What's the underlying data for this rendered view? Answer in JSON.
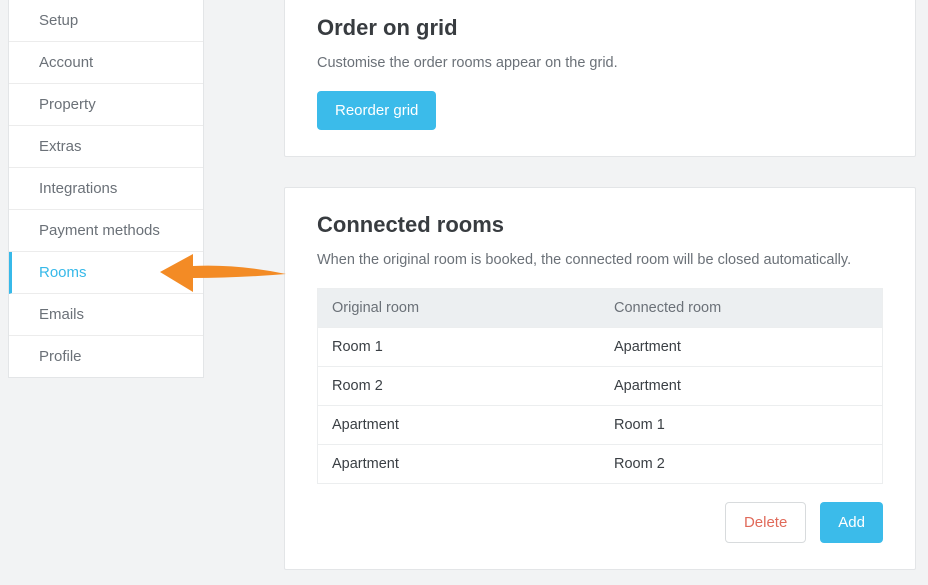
{
  "sidebar": {
    "items": [
      {
        "label": "Setup",
        "active": false
      },
      {
        "label": "Account",
        "active": false
      },
      {
        "label": "Property",
        "active": false
      },
      {
        "label": "Extras",
        "active": false
      },
      {
        "label": "Integrations",
        "active": false
      },
      {
        "label": "Payment methods",
        "active": false
      },
      {
        "label": "Rooms",
        "active": true
      },
      {
        "label": "Emails",
        "active": false
      },
      {
        "label": "Profile",
        "active": false
      }
    ]
  },
  "order_card": {
    "title": "Order on grid",
    "description": "Customise the order rooms appear on the grid.",
    "button": "Reorder grid"
  },
  "connected_card": {
    "title": "Connected rooms",
    "description": "When the original room is booked, the connected room will be closed automatically.",
    "headers": {
      "original": "Original room",
      "connected": "Connected room"
    },
    "rows": [
      {
        "original": "Room 1",
        "connected": "Apartment"
      },
      {
        "original": "Room 2",
        "connected": "Apartment"
      },
      {
        "original": "Apartment",
        "connected": "Room 1"
      },
      {
        "original": "Apartment",
        "connected": "Room 2"
      }
    ],
    "delete_label": "Delete",
    "add_label": "Add"
  }
}
